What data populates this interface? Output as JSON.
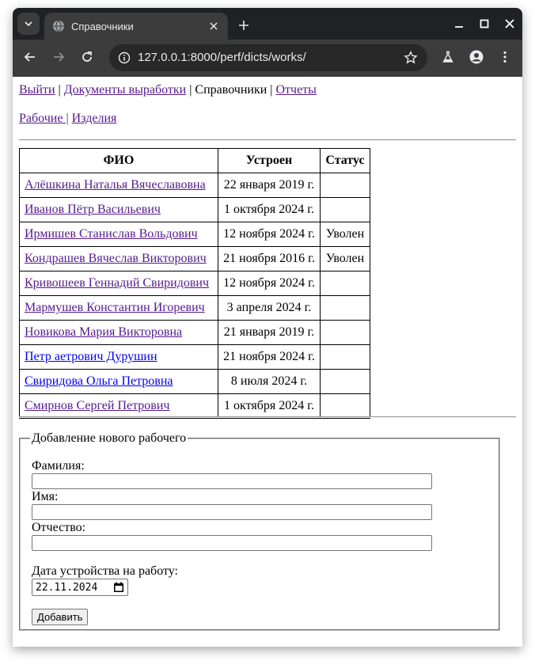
{
  "browser": {
    "tab_title": "Справочники",
    "url": "127.0.0.1:8000/perf/dicts/works/"
  },
  "nav": {
    "logout": "Выйти",
    "sep1": " | ",
    "documents": "Документы выработки",
    "sep2": " | ",
    "dicts": "Справочники",
    "sep3": " | ",
    "reports": "Отчеты",
    "workers": "Рабочие |",
    "sep4": " ",
    "products": "Изделия"
  },
  "table": {
    "headers": [
      "ФИО",
      "Устроен",
      "Статус"
    ],
    "rows": [
      {
        "fio": "Алёшкина Наталья Вячеславовна",
        "date": "22 января 2019 г.",
        "status": ""
      },
      {
        "fio": "Иванов Пётр Васильевич",
        "date": "1 октября 2024 г.",
        "status": ""
      },
      {
        "fio": "Ирмишев Станислав Вольдович",
        "date": "12 ноября 2024 г.",
        "status": "Уволен"
      },
      {
        "fio": "Кондрашев Вячеслав Викторович",
        "date": "21 ноября 2016 г.",
        "status": "Уволен"
      },
      {
        "fio": "Кривошеев Геннадий Свиридович",
        "date": "12 ноября 2024 г.",
        "status": ""
      },
      {
        "fio": "Мармушев Константин Игоревич",
        "date": "3 апреля 2024 г.",
        "status": ""
      },
      {
        "fio": "Новикова Мария Викторовна",
        "date": "21 января 2019 г.",
        "status": ""
      },
      {
        "fio": "Петр аетрович Дурушин",
        "date": "21 ноября 2024 г.",
        "status": ""
      },
      {
        "fio": "Свиридова Ольга Петровна",
        "date": "8 июля 2024 г.",
        "status": ""
      },
      {
        "fio": "Смирнов Сергей Петрович",
        "date": "1 октября 2024 г.",
        "status": ""
      }
    ]
  },
  "form": {
    "legend": "Добавление нового рабочего",
    "lastname_label": "Фамилия:",
    "lastname_value": "",
    "firstname_label": "Имя:",
    "firstname_value": "",
    "patronymic_label": "Отчество:",
    "patronymic_value": "",
    "hire_date_label": "Дата устройства на работу:",
    "hire_date_value": "22.11.2024",
    "submit_label": "Добавить"
  }
}
